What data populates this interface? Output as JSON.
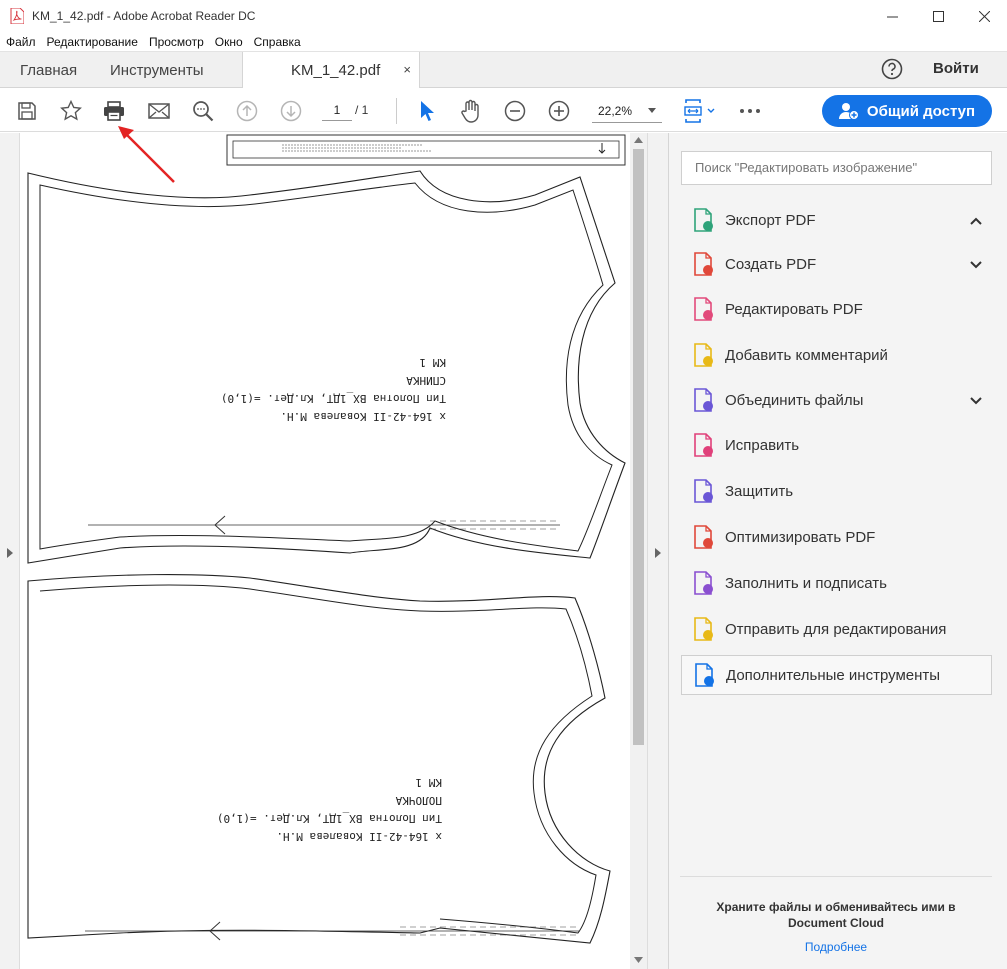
{
  "window": {
    "title": "KM_1_42.pdf - Adobe Acrobat Reader DC"
  },
  "menu": [
    "Файл",
    "Редактирование",
    "Просмотр",
    "Окно",
    "Справка"
  ],
  "tabs": {
    "home": "Главная",
    "tools": "Инструменты",
    "document": "KM_1_42.pdf",
    "close": "×"
  },
  "header": {
    "signin": "Войти"
  },
  "toolbar": {
    "page_current": "1",
    "page_total": "/ 1",
    "zoom": "22,2%",
    "share_label": "Общий доступ"
  },
  "panel": {
    "search_placeholder": "Поиск \"Редактировать изображение\"",
    "tools": [
      {
        "label": "Экспорт PDF",
        "icon": "export-pdf-icon",
        "color": "#2fa37a",
        "chevron": "up"
      },
      {
        "label": "Создать PDF",
        "icon": "create-pdf-icon",
        "color": "#e0483a",
        "chevron": "down"
      },
      {
        "label": "Редактировать PDF",
        "icon": "edit-pdf-icon",
        "color": "#e24a7b",
        "chevron": ""
      },
      {
        "label": "Добавить комментарий",
        "icon": "comment-icon",
        "color": "#e8b917",
        "chevron": ""
      },
      {
        "label": "Объединить файлы",
        "icon": "combine-files-icon",
        "color": "#6a56d6",
        "chevron": "down"
      },
      {
        "label": "Исправить",
        "icon": "redact-icon",
        "color": "#e0407a",
        "chevron": ""
      },
      {
        "label": "Защитить",
        "icon": "protect-icon",
        "color": "#6a56d6",
        "chevron": ""
      },
      {
        "label": "Оптимизировать PDF",
        "icon": "optimize-pdf-icon",
        "color": "#e0483a",
        "chevron": ""
      },
      {
        "label": "Заполнить и подписать",
        "icon": "fill-sign-icon",
        "color": "#8a4fd0",
        "chevron": ""
      },
      {
        "label": "Отправить для редактирования",
        "icon": "send-review-icon",
        "color": "#e8b917",
        "chevron": ""
      },
      {
        "label": "Дополнительные инструменты",
        "icon": "more-tools-icon",
        "color": "#1473e6",
        "chevron": ""
      }
    ],
    "cloud_text_1": "Храните файлы и обменивайтесь ими в",
    "cloud_text_2": "Document Cloud",
    "cloud_link": "Подробнее"
  },
  "document": {
    "piece1": {
      "line1": "х 164-42-II Ковалева М.Н.",
      "line2": "Тип Полотна ВХ_1ДТ, Кл.Дет. =(1,0)",
      "line3": "СПИНКА",
      "line4": "КМ 1"
    },
    "piece2": {
      "line1": "х 164-42-II Ковалева М.Н.",
      "line2": "Тип Полотна ВХ_1ДТ, Кл.Дет. =(1,0)",
      "line3": "ПОЛОЧКА",
      "line4": "КМ 1"
    }
  }
}
